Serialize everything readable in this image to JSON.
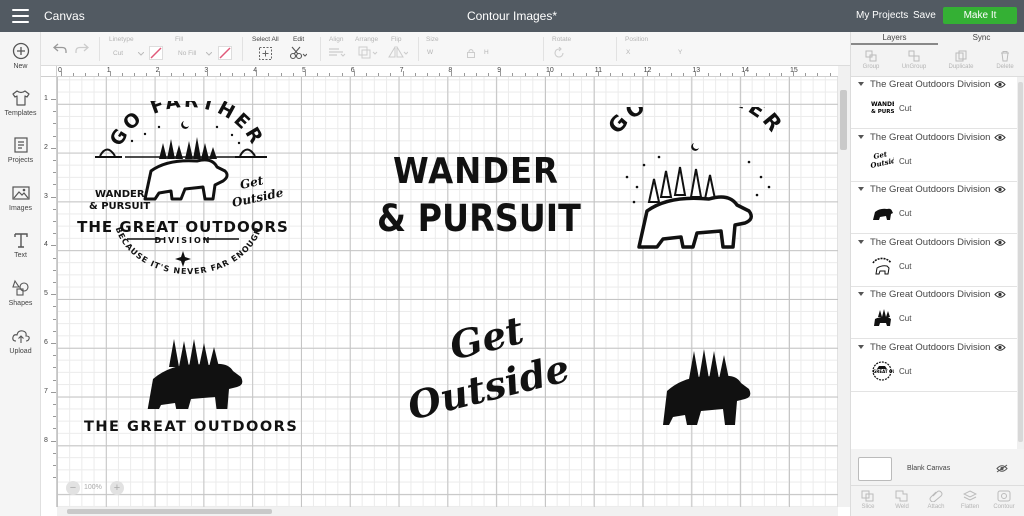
{
  "header": {
    "app_name": "Canvas",
    "title": "Contour Images*",
    "my_projects": "My Projects",
    "save": "Save",
    "make_it": "Make It",
    "make_it_color": "#34b034",
    "bar_color": "#525a62"
  },
  "sidebar": {
    "items": [
      {
        "label": "New",
        "icon": "plus-circle-icon"
      },
      {
        "label": "Templates",
        "icon": "shirt-icon"
      },
      {
        "label": "Projects",
        "icon": "projects-icon"
      },
      {
        "label": "Images",
        "icon": "image-icon"
      },
      {
        "label": "Text",
        "icon": "text-t-icon"
      },
      {
        "label": "Shapes",
        "icon": "shapes-icon"
      },
      {
        "label": "Upload",
        "icon": "upload-cloud-icon"
      }
    ]
  },
  "toolbar": {
    "linetype_label": "Linetype",
    "linetype_value": "Cut",
    "fill_label": "Fill",
    "fill_value": "No Fill",
    "select_all_label": "Select All",
    "edit_label": "Edit",
    "align_label": "Align",
    "arrange_label": "Arrange",
    "flip_label": "Flip",
    "size_label": "Size",
    "size_w": "W",
    "size_h": "H",
    "rotate_label": "Rotate",
    "position_label": "Position",
    "pos_x": "X",
    "pos_y": "Y"
  },
  "rulers": {
    "top": [
      "0",
      "1",
      "2",
      "3",
      "4",
      "5",
      "6",
      "7",
      "8",
      "9",
      "10",
      "11",
      "12",
      "13",
      "14",
      "15",
      "16"
    ],
    "left": [
      "1",
      "2",
      "3",
      "4",
      "5",
      "6",
      "7",
      "8"
    ]
  },
  "zoom": {
    "value": "100%",
    "minus": "−",
    "plus": "+"
  },
  "panel": {
    "tabs": [
      "Layers",
      "Sync"
    ],
    "tools": [
      "Group",
      "UnGroup",
      "Duplicate",
      "Delete"
    ],
    "layers": [
      {
        "name": "The Great Outdoors Division",
        "op": "Cut",
        "thumb": "wander-pursuit-thumb"
      },
      {
        "name": "The Great Outdoors Division",
        "op": "Cut",
        "thumb": "get-outside-thumb"
      },
      {
        "name": "The Great Outdoors Division",
        "op": "Cut",
        "thumb": "small-bear-thumb"
      },
      {
        "name": "The Great Outdoors Division",
        "op": "Cut",
        "thumb": "go-farther-thumb"
      },
      {
        "name": "The Great Outdoors Division",
        "op": "Cut",
        "thumb": "bear-trees-thumb"
      },
      {
        "name": "The Great Outdoors Division",
        "op": "Cut",
        "thumb": "badge-thumb"
      }
    ],
    "blank_canvas": "Blank Canvas",
    "bottom_tools": [
      "Slice",
      "Weld",
      "Attach",
      "Flatten",
      "Contour"
    ]
  },
  "designs": {
    "badge": {
      "top_arc": "GO FARTHER",
      "left_text_1": "WANDER",
      "left_text_2": "& PURSUIT",
      "right_text_1": "Get",
      "right_text_2": "Outside",
      "main": "THE GREAT OUTDOORS",
      "sub": "DIVISION",
      "bottom_arc": "BECAUSE IT'S NEVER FAR ENOUGH"
    },
    "wander": {
      "line1": "WANDER",
      "line2": "& PURSUIT"
    },
    "go_farther": {
      "arc": "GO FARTHER"
    },
    "bear_trees": {
      "caption": "THE GREAT OUTDOORS"
    },
    "get_outside": {
      "line1": "Get",
      "line2": "Outside"
    }
  }
}
